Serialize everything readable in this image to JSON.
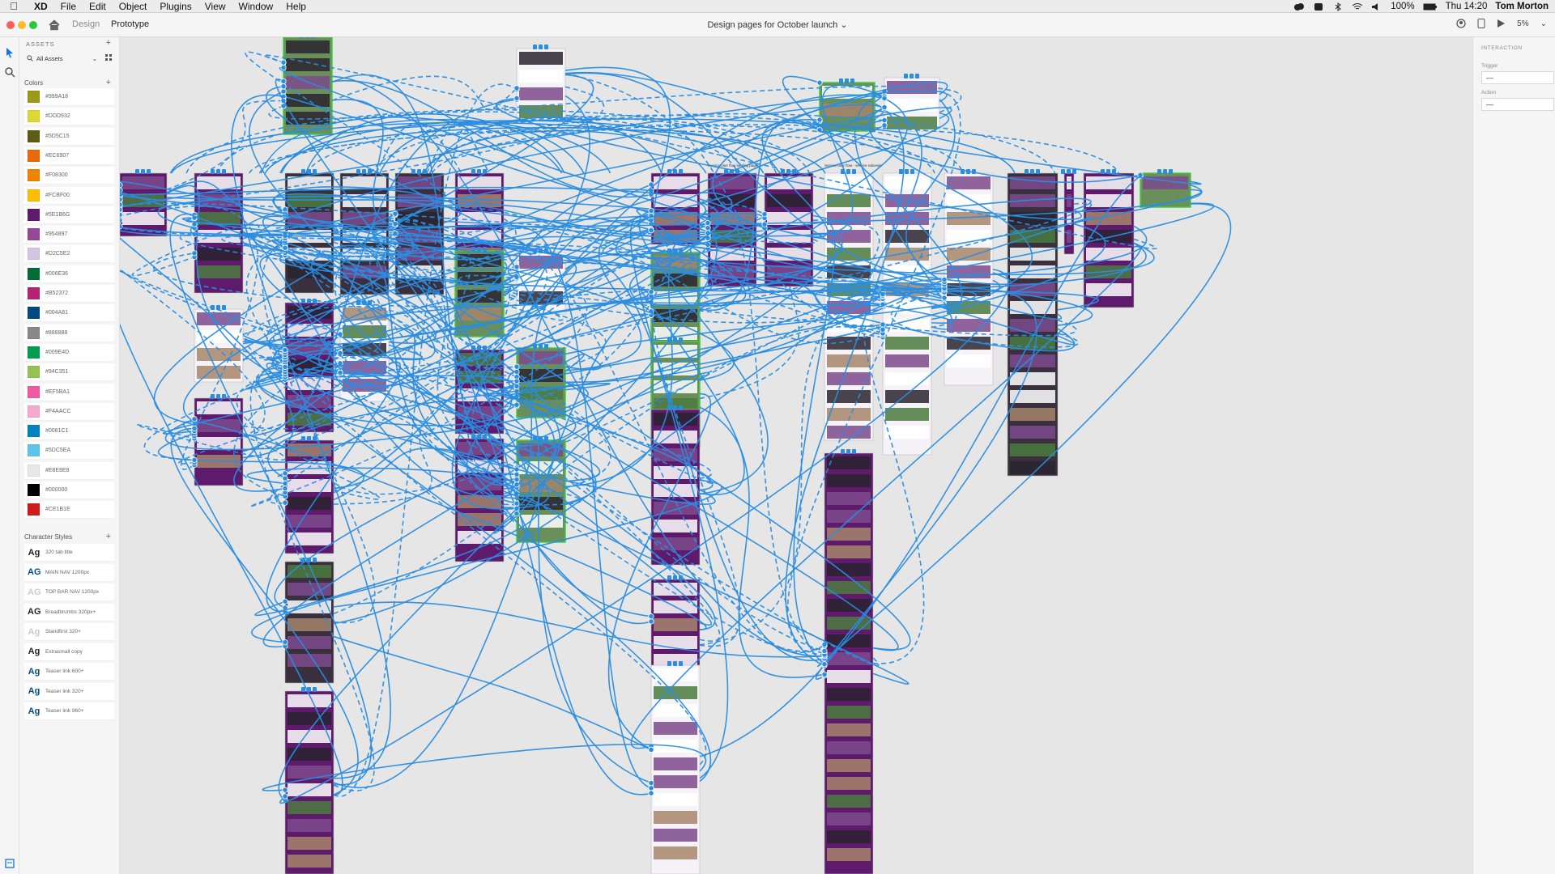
{
  "menubar": {
    "app_name": "XD",
    "menus": [
      "File",
      "Edit",
      "Object",
      "Plugins",
      "View",
      "Window",
      "Help"
    ],
    "battery": "100%",
    "clock": "Thu 14:20",
    "user": "Tom Morton"
  },
  "titlebar": {
    "tabs": [
      "Design",
      "Prototype"
    ],
    "active_tab": "Prototype",
    "document_title": "Design pages for October launch",
    "zoom": "5%"
  },
  "assets": {
    "heading": "ASSETS",
    "filter": "All Assets",
    "colors_heading": "Colors",
    "colors": [
      "#999A18",
      "#DDD932",
      "#5D5C15",
      "#EC6907",
      "#F08300",
      "#FCBF00",
      "#5E1B6G",
      "#954897",
      "#D2C5E2",
      "#006E36",
      "#B52372",
      "#004A81",
      "#888888",
      "#009E4D",
      "#94C351",
      "#EF5BA1",
      "#F4AACC",
      "#0081C1",
      "#5DC5EA",
      "#E8E8E8",
      "#000000",
      "#CE1B1E"
    ],
    "swatches": [
      "#999a18",
      "#ddd932",
      "#5d5c15",
      "#ec6907",
      "#f08300",
      "#fcbf00",
      "#5e1b6b",
      "#954897",
      "#d2c5e2",
      "#006e36",
      "#b52372",
      "#004a81",
      "#888888",
      "#009e4d",
      "#94c351",
      "#ef5ba1",
      "#f4aacc",
      "#0081c1",
      "#5dc5ea",
      "#e8e8e8",
      "#000000",
      "#ce1b1e"
    ],
    "character_styles_heading": "Character Styles",
    "character_styles": [
      {
        "sample": "Ag",
        "name": "320 tab title",
        "color": "#222222"
      },
      {
        "sample": "AG",
        "name": "MAIN NAV 1200px",
        "color": "#004a81"
      },
      {
        "sample": "AG",
        "name": "TOP BAR NAV 1200px",
        "color": "#cccccc"
      },
      {
        "sample": "AG",
        "name": "Breadbrumbs 320px+",
        "color": "#222222"
      },
      {
        "sample": "Ag",
        "name": "Standfirst 320+",
        "color": "#cccccc"
      },
      {
        "sample": "Ag",
        "name": "Extrasmall copy",
        "color": "#222222"
      },
      {
        "sample": "Ag",
        "name": "Teaser link 600+",
        "color": "#004a81"
      },
      {
        "sample": "Ag",
        "name": "Teaser link 320+",
        "color": "#004a81"
      },
      {
        "sample": "Ag",
        "name": "Teaser link 960+",
        "color": "#004a81"
      }
    ]
  },
  "inspector": {
    "heading": "INTERACTION",
    "trigger_label": "Trigger",
    "trigger_value": "—",
    "action_label": "Action",
    "action_value": "—"
  },
  "canvas": {
    "wire_color": "#2a8de0",
    "selection_color": "#3fcf3f",
    "artboard_labels": [
      "Service user flow landing page",
      "Service user flow - service rationale"
    ]
  }
}
